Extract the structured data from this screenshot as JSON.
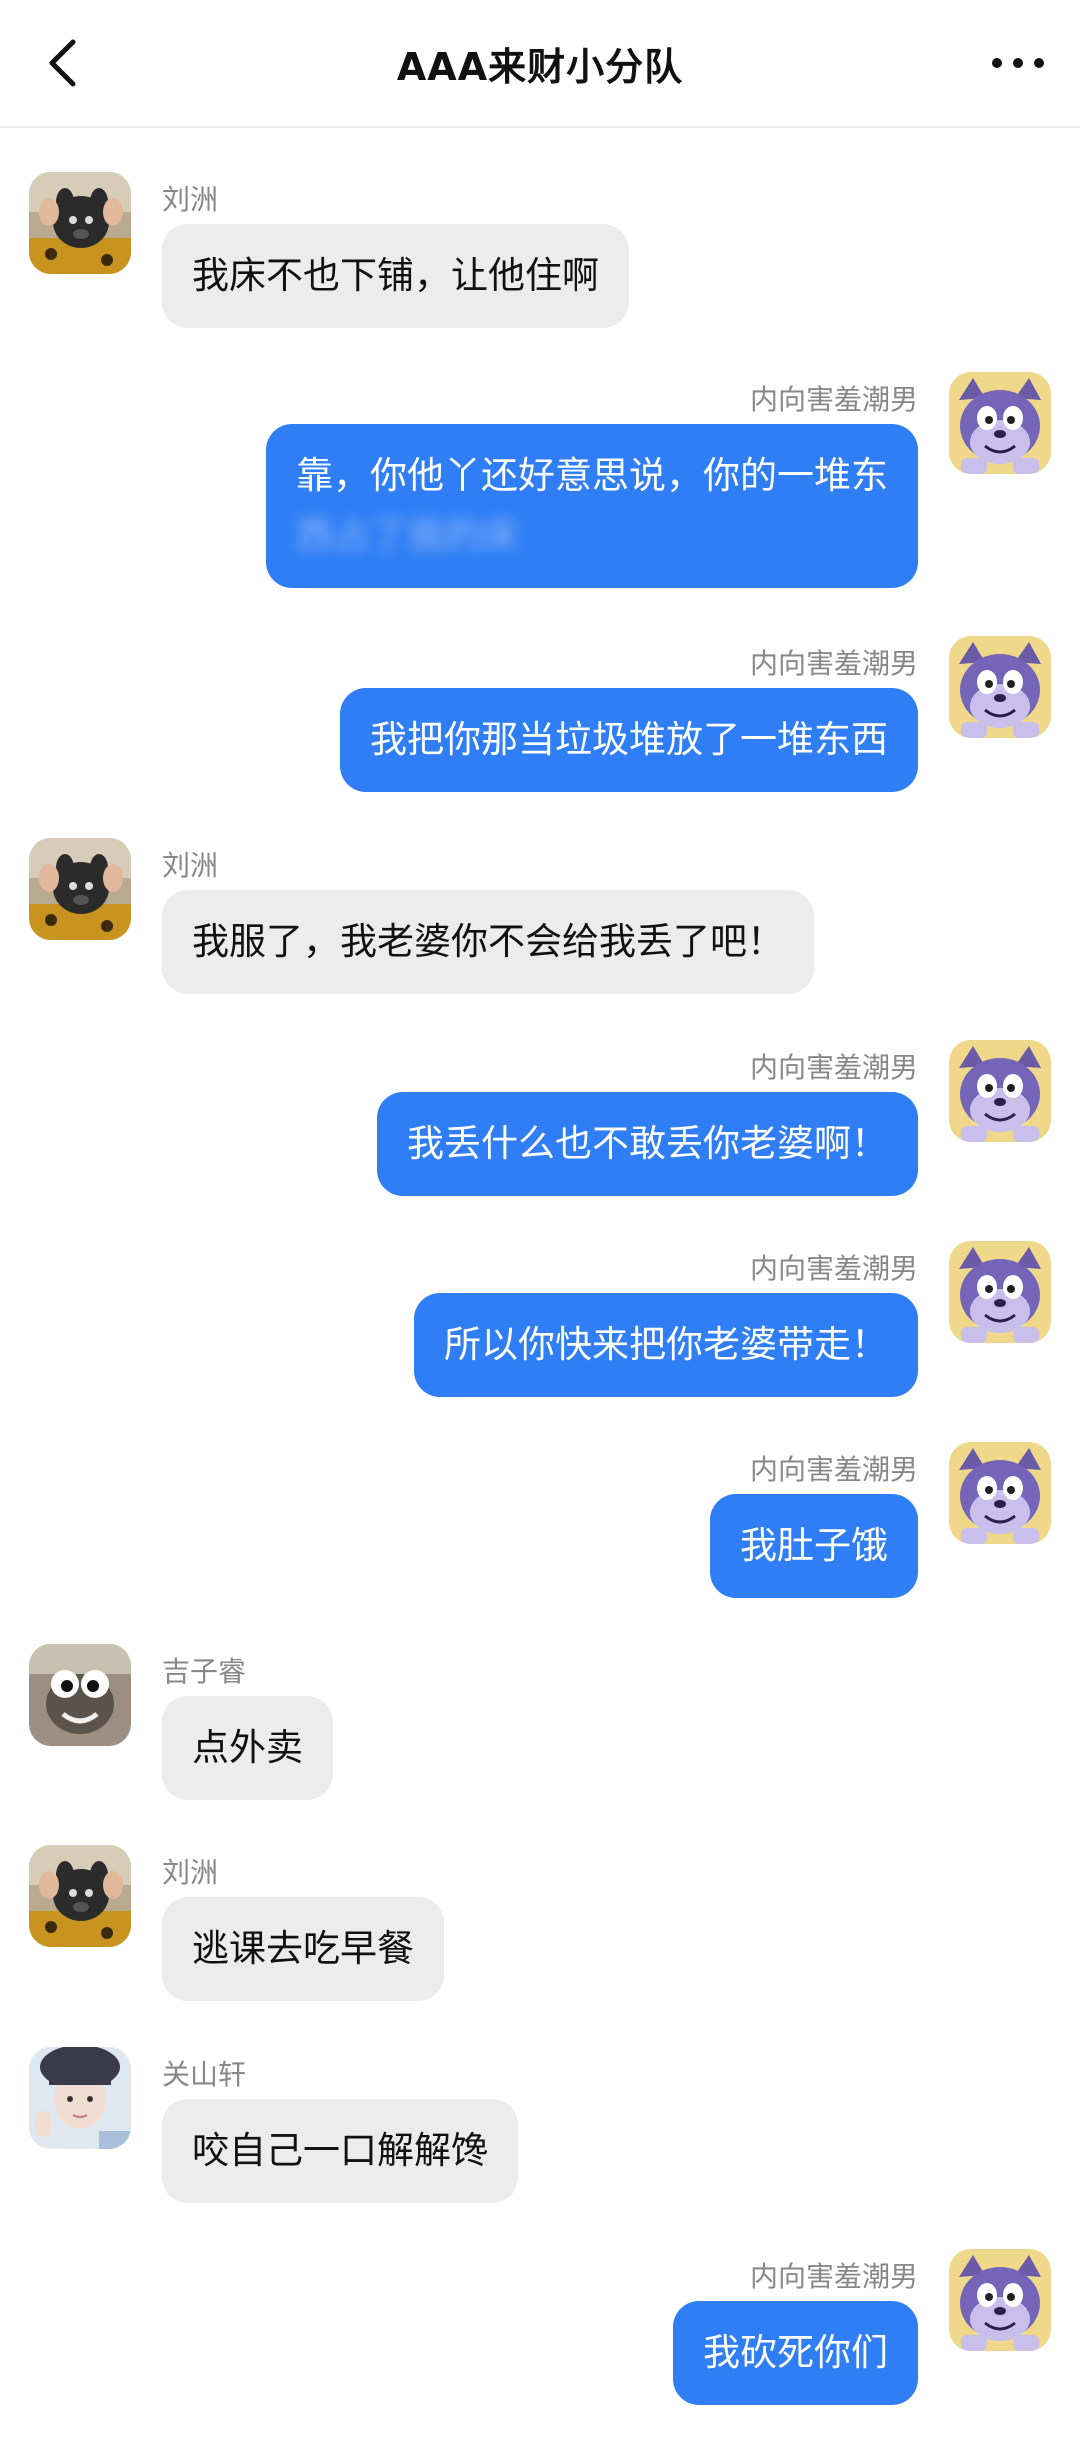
{
  "header": {
    "title": "AAA来财小分队",
    "back_icon": "chevron-left-icon",
    "more_icon": "more-horizontal-icon"
  },
  "colors": {
    "accent": "#2f7ef5",
    "bubble_received": "#ececed",
    "text_primary": "#111111",
    "text_secondary": "#888888"
  },
  "messages": [
    {
      "side": "left",
      "sender": "刘洲",
      "avatar": "avatar-liuzhou",
      "lines": [
        "我床不也下铺，让他住啊"
      ]
    },
    {
      "side": "right",
      "sender": "内向害羞潮男",
      "avatar": "avatar-tom-cat",
      "lines": [
        "靠，你他丫还好意思说，你的一堆东",
        "西占了我的床"
      ]
    },
    {
      "side": "right",
      "sender": "内向害羞潮男",
      "avatar": "avatar-tom-cat",
      "lines": [
        "我把你那当垃圾堆放了一堆东西"
      ]
    },
    {
      "side": "left",
      "sender": "刘洲",
      "avatar": "avatar-liuzhou",
      "lines": [
        "我服了，我老婆你不会给我丢了吧！"
      ]
    },
    {
      "side": "right",
      "sender": "内向害羞潮男",
      "avatar": "avatar-tom-cat",
      "lines": [
        "我丢什么也不敢丢你老婆啊！"
      ]
    },
    {
      "side": "right",
      "sender": "内向害羞潮男",
      "avatar": "avatar-tom-cat",
      "lines": [
        "所以你快来把你老婆带走！"
      ]
    },
    {
      "side": "right",
      "sender": "内向害羞潮男",
      "avatar": "avatar-tom-cat",
      "lines": [
        "我肚子饿"
      ]
    },
    {
      "side": "left",
      "sender": "吉子睿",
      "avatar": "avatar-jizirui",
      "lines": [
        "点外卖"
      ]
    },
    {
      "side": "left",
      "sender": "刘洲",
      "avatar": "avatar-liuzhou",
      "lines": [
        "逃课去吃早餐"
      ]
    },
    {
      "side": "left",
      "sender": "关山轩",
      "avatar": "avatar-guanshanxuan",
      "lines": [
        "咬自己一口解解馋"
      ]
    },
    {
      "side": "right",
      "sender": "内向害羞潮男",
      "avatar": "avatar-tom-cat",
      "lines": [
        "我砍死你们"
      ]
    }
  ]
}
